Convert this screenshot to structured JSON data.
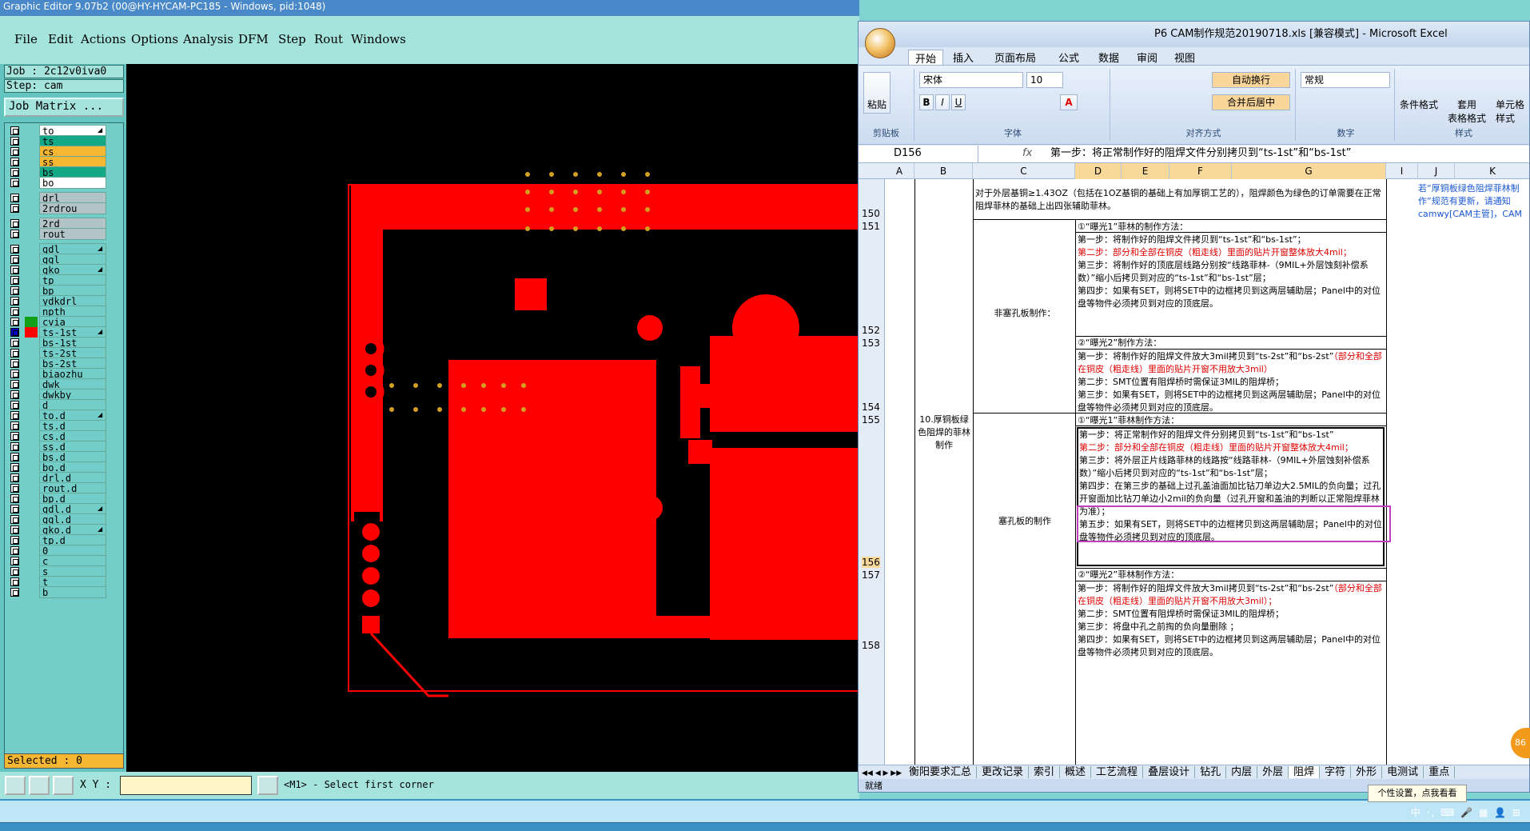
{
  "ge": {
    "title": "Graphic Editor 9.07b2 (00@HY-HYCAM-PC185 - Windows, pid:1048)",
    "menu": [
      "File",
      "Edit",
      "Actions",
      "Options",
      "Analysis",
      "DFM",
      "Step",
      "Rout",
      "Windows"
    ],
    "job": "Job  : 2c12v0iva0",
    "step": "Step: cam",
    "job_matrix": "Job Matrix ...",
    "layers": [
      {
        "name": "to",
        "color": "#ffffff",
        "mark": true
      },
      {
        "name": "ts",
        "color": "#13a886",
        "mark": false
      },
      {
        "name": "cs",
        "color": "#f5b731",
        "mark": false
      },
      {
        "name": "ss",
        "color": "#f5b731",
        "mark": false
      },
      {
        "name": "bs",
        "color": "#13a886",
        "mark": false
      },
      {
        "name": "bo",
        "color": "#ffffff",
        "mark": false
      },
      {
        "name": "drl",
        "color": "#b3c4c8",
        "mark": false
      },
      {
        "name": "2rdrou",
        "color": "#b3c4c8",
        "mark": false
      },
      {
        "name": "2rd",
        "color": "#b3c4c8",
        "mark": false
      },
      {
        "name": "rout",
        "color": "#b3c4c8",
        "mark": false
      },
      {
        "name": "gdl",
        "color": "#73cec9",
        "mark": true
      },
      {
        "name": "ggl",
        "color": "#73cec9",
        "mark": false
      },
      {
        "name": "gko",
        "color": "#73cec9",
        "mark": true
      },
      {
        "name": "tp",
        "color": "#73cec9",
        "mark": false
      },
      {
        "name": "bp",
        "color": "#73cec9",
        "mark": false
      },
      {
        "name": "ydkdrl",
        "color": "#73cec9",
        "mark": false
      },
      {
        "name": "npth",
        "color": "#73cec9",
        "mark": false
      },
      {
        "name": "cvia",
        "color": "#73cec9",
        "mark": false
      },
      {
        "name": "ts-1st",
        "color": "#73cec9",
        "mark": true
      },
      {
        "name": "bs-1st",
        "color": "#73cec9",
        "mark": false
      },
      {
        "name": "ts-2st",
        "color": "#73cec9",
        "mark": false
      },
      {
        "name": "bs-2st",
        "color": "#73cec9",
        "mark": false
      },
      {
        "name": "biaozhu",
        "color": "#73cec9",
        "mark": false
      },
      {
        "name": "dwk",
        "color": "#73cec9",
        "mark": false
      },
      {
        "name": "dwkby",
        "color": "#73cec9",
        "mark": false
      },
      {
        "name": "d",
        "color": "#73cec9",
        "mark": false
      },
      {
        "name": "to.d",
        "color": "#73cec9",
        "mark": true
      },
      {
        "name": "ts.d",
        "color": "#73cec9",
        "mark": false
      },
      {
        "name": "cs.d",
        "color": "#73cec9",
        "mark": false
      },
      {
        "name": "ss.d",
        "color": "#73cec9",
        "mark": false
      },
      {
        "name": "bs.d",
        "color": "#73cec9",
        "mark": false
      },
      {
        "name": "bo.d",
        "color": "#73cec9",
        "mark": false
      },
      {
        "name": "drl.d",
        "color": "#73cec9",
        "mark": false
      },
      {
        "name": "rout.d",
        "color": "#73cec9",
        "mark": false
      },
      {
        "name": "bp.d",
        "color": "#73cec9",
        "mark": false
      },
      {
        "name": "gdl.d",
        "color": "#73cec9",
        "mark": true
      },
      {
        "name": "ggl.d",
        "color": "#73cec9",
        "mark": false
      },
      {
        "name": "gko.d",
        "color": "#73cec9",
        "mark": true
      },
      {
        "name": "tp.d",
        "color": "#73cec9",
        "mark": false
      },
      {
        "name": "0",
        "color": "#73cec9",
        "mark": false
      },
      {
        "name": "c",
        "color": "#73cec9",
        "mark": false
      },
      {
        "name": "s",
        "color": "#73cec9",
        "mark": false
      },
      {
        "name": "t",
        "color": "#73cec9",
        "mark": false
      },
      {
        "name": "b",
        "color": "#73cec9",
        "mark": false
      }
    ],
    "selected": "Selected : 0",
    "xy_label": "X Y :",
    "xy_value": "",
    "prompt": "<M1> - Select first corner",
    "pcb_color": "#ff0000",
    "accent_active": "#0000cc"
  },
  "excel": {
    "title": "P6 CAM制作规范20190718.xls  [兼容模式] - Microsoft Excel",
    "tabs": [
      "开始",
      "插入",
      "页面布局",
      "公式",
      "数据",
      "审阅",
      "视图"
    ],
    "font_name": "宋体",
    "font_size": "10",
    "number_format": "常规",
    "wrap_label": "自动换行",
    "merge_label": "合并后居中",
    "paste_label": "粘贴",
    "cond_format": "条件格式",
    "table_format_1": "套用",
    "table_format_2": "表格格式",
    "cell_style_1": "单元格",
    "cell_style_2": "样式",
    "groups": [
      "剪贴板",
      "字体",
      "对齐方式",
      "数字",
      "样式"
    ],
    "cell_ref": "D156",
    "fx": "fx",
    "formula": "第一步：将正常制作好的阻焊文件分别拷贝到“ts-1st”和“bs-1st”",
    "columns": [
      "A",
      "B",
      "C",
      "D",
      "E",
      "F",
      "G",
      "I",
      "J",
      "K"
    ],
    "rows": [
      "150",
      "151",
      "152",
      "153",
      "154",
      "155",
      "156",
      "157",
      "158"
    ],
    "r150_text": "对于外层基铜≥1.43OZ（包括在1OZ基铜的基础上有加厚铜工艺的），阻焊颜色为绿色的订单需要在正常阻焊菲林的基础上出四张辅助菲林。",
    "r150_note": "若“厚铜板绿色阻焊菲林制作”规范有更新，请通知camwy[CAM主管]，CAM工程文员]通知各CAM",
    "label_fsk": "非塞孔板制作：",
    "label_main": "10.厚铜板绿色阻焊的菲林制作",
    "label_sk": "塞孔板的制作",
    "s1_title": "①“曝光1”菲林的制作方法：",
    "s1_1": "第一步：将制作好的阻焊文件拷贝到“ts-1st”和“bs-1st”；",
    "s1_2": "第二步：部分和全部在铜皮（粗走线）里面的贴片开窗整体放大4mil；",
    "s1_3": "第三步：将制作好的顶底层线路分别按“线路菲林-（9MIL+外层蚀刻补偿系数）”缩小后拷贝到对应的“ts-1st”和“bs-1st”层；",
    "s1_4": "第四步：如果有SET，则将SET中的边框拷贝到这两层辅助层；Panel中的对位盘等物件必须拷贝到对应的顶底层。",
    "s2_title": "②“曝光2”制作方法：",
    "s2_1": "第一步：将制作好的阻焊文件放大3mil拷贝到“ts-2st”和“bs-2st”",
    "s2_1r": "（部分和全部在铜皮（粗走线）里面的贴片开窗不用放大3mil）",
    "s2_2": "第二步：SMT位置有阻焊桥时需保证3MIL的阻焊桥；",
    "s2_3": "第三步：如果有SET，则将SET中的边框拷贝到这两层辅助层；Panel中的对位盘等物件必须拷贝到对应的顶底层。",
    "s3_title": "①“曝光1”菲林制作方法：",
    "s3_1": "第一步：将正常制作好的阻焊文件分别拷贝到“ts-1st”和“bs-1st”",
    "s3_2": "第二步：部分和全部在铜皮（粗走线）里面的贴片开窗整体放大4mil；",
    "s3_3": "第三步：将外层正片线路菲林的线路按“线路菲林-（9MIL+外层蚀刻补偿系数）”缩小后拷贝到对应的“ts-1st”和“bs-1st”层；",
    "s3_4": "第四步：在第三步的基础上过孔盖油面加比钻刀单边大2.5MIL的负向量；过孔开窗面加比钻刀单边小2mil的负向量（过孔开窗和盖油的判断以正常阻焊菲林为准）；",
    "s3_5": "第五步：如果有SET，则将SET中的边框拷贝到这两层辅助层；Panel中的对位盘等物件必须拷贝到对应的顶底层。",
    "s4_title": "②“曝光2”菲林制作方法：",
    "s4_1": "第一步：将制作好的阻焊文件放大3mil拷贝到“ts-2st”和“bs-2st”",
    "s4_1r": "（部分和全部在铜皮（粗走线）里面的贴片开窗不用放大3mil）；",
    "s4_2": "第二步：SMT位置有阻焊桥时需保证3MIL的阻焊桥；",
    "s4_3": "第三步：将盘中孔之前掏的负向量删除 ；",
    "s4_4": "第四步：如果有SET，则将SET中的边框拷贝到这两层辅助层；Panel中的对位盘等物件必须拷贝到对应的顶底层。",
    "sheet_tabs": [
      "衡阳要求汇总",
      "更改记录",
      "索引",
      "概述",
      "工艺流程",
      "叠层设计",
      "钻孔",
      "内层",
      "外层",
      "阻焊",
      "字符",
      "外形",
      "电测试",
      "重点"
    ],
    "status": "就绪",
    "badge": "86",
    "tooltip": "个性设置，点我看看",
    "ime": "中 ·, ⌨ 🎤 ▦ 👤 ⊞"
  }
}
